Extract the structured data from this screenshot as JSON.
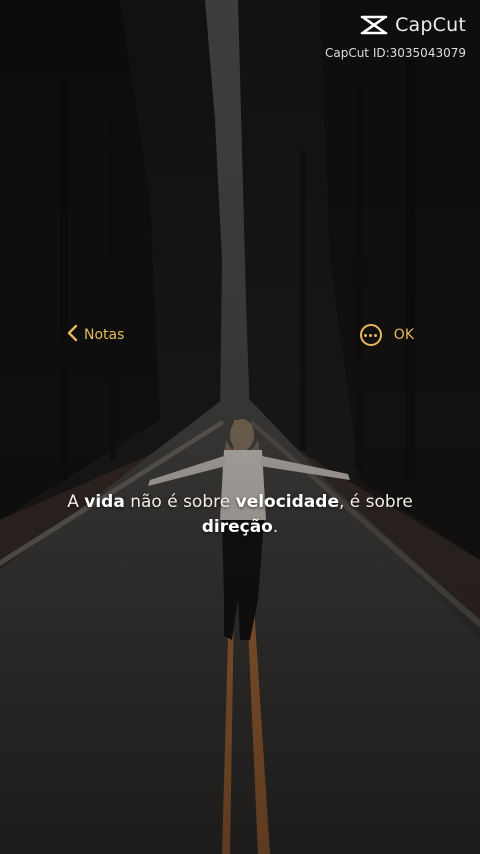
{
  "watermark": {
    "brand": "CapCut",
    "id_text": "CapCut ID:3035043079"
  },
  "notes_header": {
    "back_label": "Notas",
    "ok_label": "OK"
  },
  "quote": {
    "part1": "A ",
    "bold1": "vida",
    "part2": " não é sobre ",
    "bold2": "velocidade",
    "part3": ", é sobre ",
    "bold3": "direção",
    "part4": "."
  },
  "colors": {
    "accent": "#e6b85c",
    "text": "#f1ede6"
  },
  "icons": {
    "back": "chevron-left-icon",
    "more": "more-dots-icon",
    "brand": "capcut-logo-icon"
  }
}
